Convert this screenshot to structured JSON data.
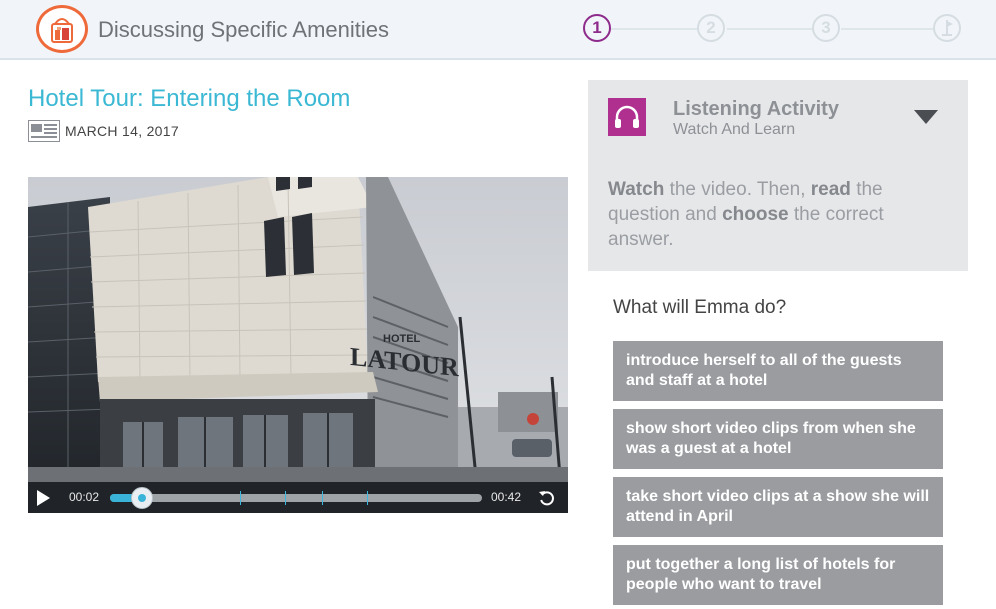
{
  "header": {
    "app_title": "Discussing Specific Amenities",
    "steps": [
      "1",
      "2",
      "3"
    ],
    "active_step": 1
  },
  "lesson": {
    "title": "Hotel Tour: Entering the Room",
    "date": "MARCH 14, 2017"
  },
  "video": {
    "current_time": "00:02",
    "total_time": "00:42",
    "progress": 0.07,
    "cue_points": [
      0.35,
      0.47,
      0.57,
      0.69
    ],
    "sign_small": "HOTEL",
    "sign_large": "LATOUR"
  },
  "activity": {
    "title": "Listening Activity",
    "subtitle": "Watch And Learn",
    "instructions": {
      "w1": "Watch",
      "t1": " the video. Then, ",
      "w2": "read",
      "t2": " the question and ",
      "w3": "choose",
      "t3": " the correct answer."
    }
  },
  "question": "What will Emma do?",
  "answers": [
    "introduce herself to all of the guests and staff at a hotel",
    "show short video clips from when she was a guest at a hotel",
    "take short video clips at a show she will attend in April",
    "put together a long list of hotels for people who want to travel"
  ],
  "colors": {
    "accent_title": "#3bb8d3",
    "step_active": "#8e2a8b",
    "activity_icon": "#b0308f",
    "answer_bg": "#9a9ca0",
    "logo": "#ef6a3a"
  }
}
